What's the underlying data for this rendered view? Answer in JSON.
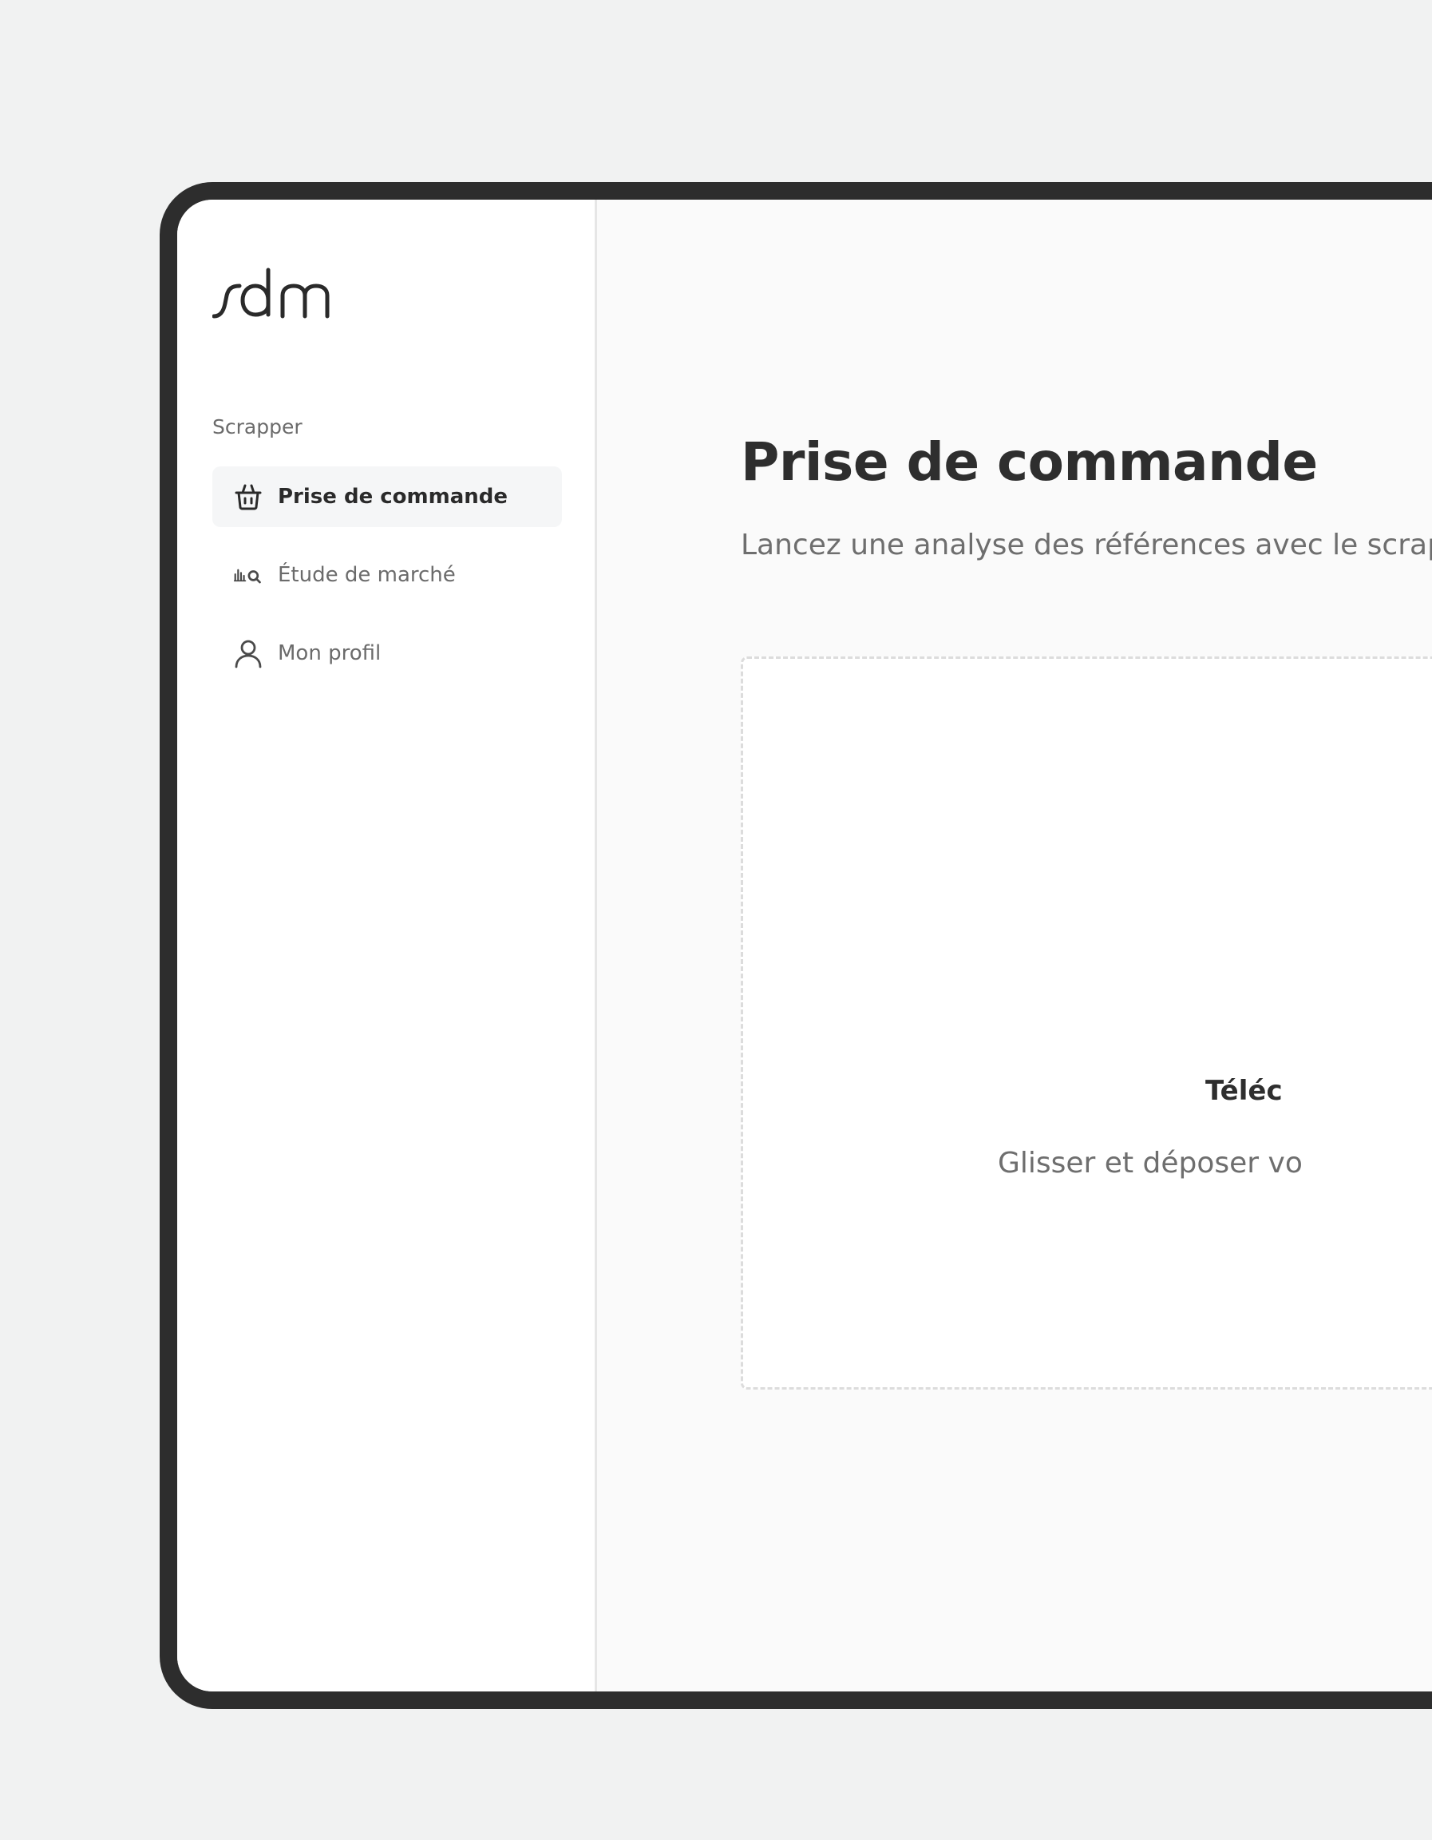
{
  "app": {
    "logo_text": "sdm"
  },
  "sidebar": {
    "section_label": "Scrapper",
    "items": [
      {
        "label": "Prise de commande",
        "icon": "basket-icon",
        "active": true
      },
      {
        "label": "Étude de marché",
        "icon": "chart-search-icon",
        "active": false
      },
      {
        "label": "Mon profil",
        "icon": "user-icon",
        "active": false
      }
    ]
  },
  "main": {
    "title": "Prise de commande",
    "subtitle": "Lancez une analyse des références avec le scrap",
    "dropzone": {
      "title": "Téléc",
      "hint": "Glisser et déposer vo"
    }
  },
  "colors": {
    "background": "#f1f2f2",
    "device_frame": "#2d2d2d",
    "sidebar_bg": "#ffffff",
    "main_bg": "#fafafa",
    "active_item_bg": "#f5f6f7",
    "text_primary": "#2e2e2e",
    "text_secondary": "#6e6e6e"
  }
}
